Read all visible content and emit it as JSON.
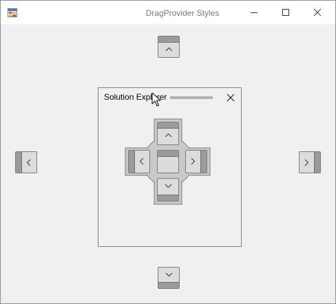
{
  "window": {
    "title": "DragProvider Styles",
    "controls": {
      "minimize_icon": "minimize-icon",
      "maximize_icon": "maximize-icon",
      "close_icon": "close-icon"
    }
  },
  "dock_panel": {
    "title": "Solution Explorer",
    "close_icon": "close-icon"
  },
  "dock_guides": {
    "outer": [
      "top",
      "bottom",
      "left",
      "right"
    ],
    "center_compass": [
      "top",
      "bottom",
      "left",
      "right",
      "fill"
    ]
  },
  "colors": {
    "background": "#f0f0f0",
    "titlebar": "#ffffff",
    "guide_fill": "#dcdcdc",
    "guide_band": "#9b9b9b",
    "guide_border": "#7c7c7c",
    "compass_fill": "#cacaca"
  }
}
